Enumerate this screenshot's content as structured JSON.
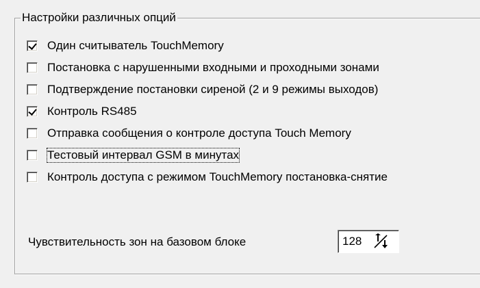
{
  "group": {
    "title": "Настройки различных опций"
  },
  "options": [
    {
      "label": "Один считыватель TouchMemory",
      "checked": true
    },
    {
      "label": "Постановка с нарушенными входными и проходными зонами",
      "checked": false
    },
    {
      "label": "Подтверждение постановки сиреной (2 и 9 режимы выходов)",
      "checked": false
    },
    {
      "label": "Контроль RS485",
      "checked": true
    },
    {
      "label": "Отправка сообщения о контроле доступа Touch Memory",
      "checked": false
    },
    {
      "label": "Тестовый интервал GSM в минутах",
      "checked": false
    },
    {
      "label": "Контроль доступа с режимом TouchMemory постановка-снятие",
      "checked": false
    }
  ],
  "sensitivity": {
    "label": "Чувствительность зон на базовом блоке",
    "value": "128",
    "arrows_icon": "spin-up-down-icon"
  }
}
